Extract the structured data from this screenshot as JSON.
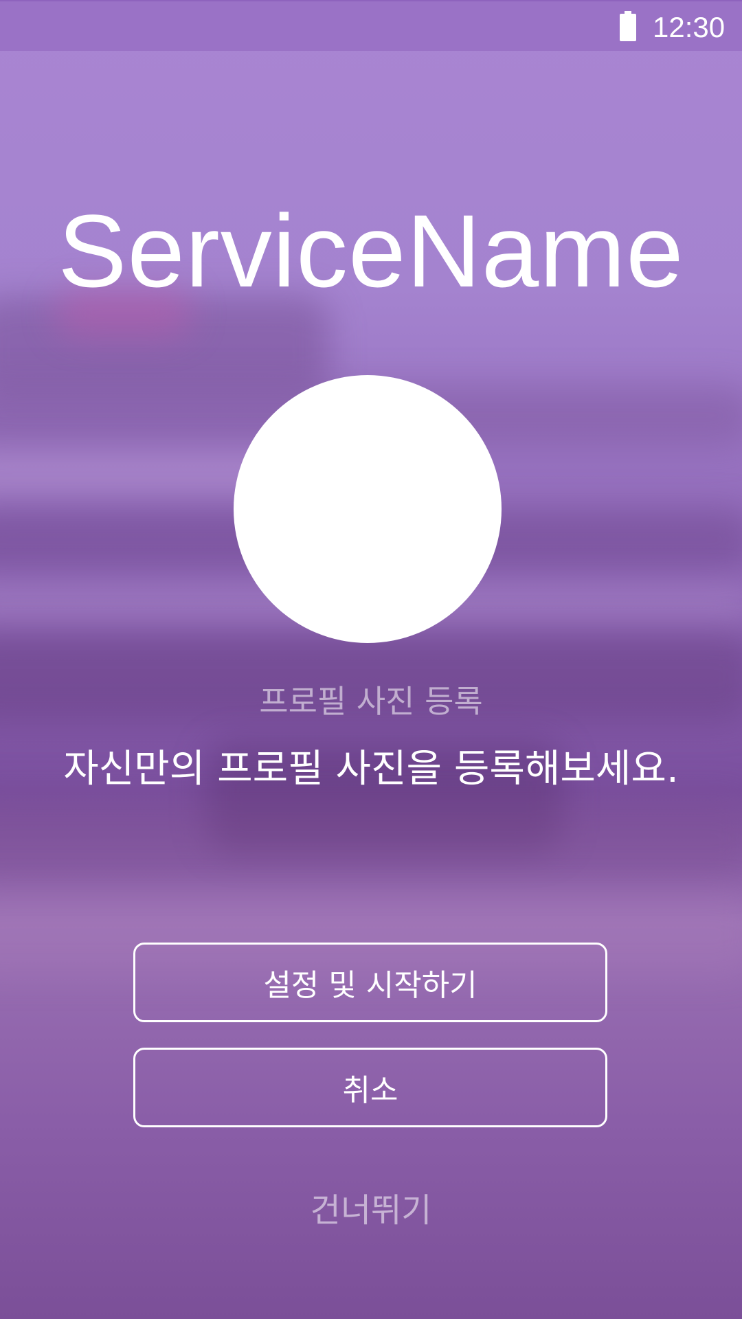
{
  "status_bar": {
    "time": "12:30",
    "battery_icon": "battery-full-icon"
  },
  "app": {
    "service_name": "ServiceName"
  },
  "profile": {
    "avatar_icon": "profile-photo-placeholder",
    "caption": "프로필 사진 등록",
    "subtitle": "자신만의 프로필 사진을 등록해보세요."
  },
  "actions": {
    "start_label": "설정 및 시작하기",
    "cancel_label": "취소",
    "skip_label": "건너뛰기"
  },
  "colors": {
    "background": "#9a72c6",
    "text": "#ffffff",
    "muted_text": "rgba(255,255,255,0.55)"
  }
}
